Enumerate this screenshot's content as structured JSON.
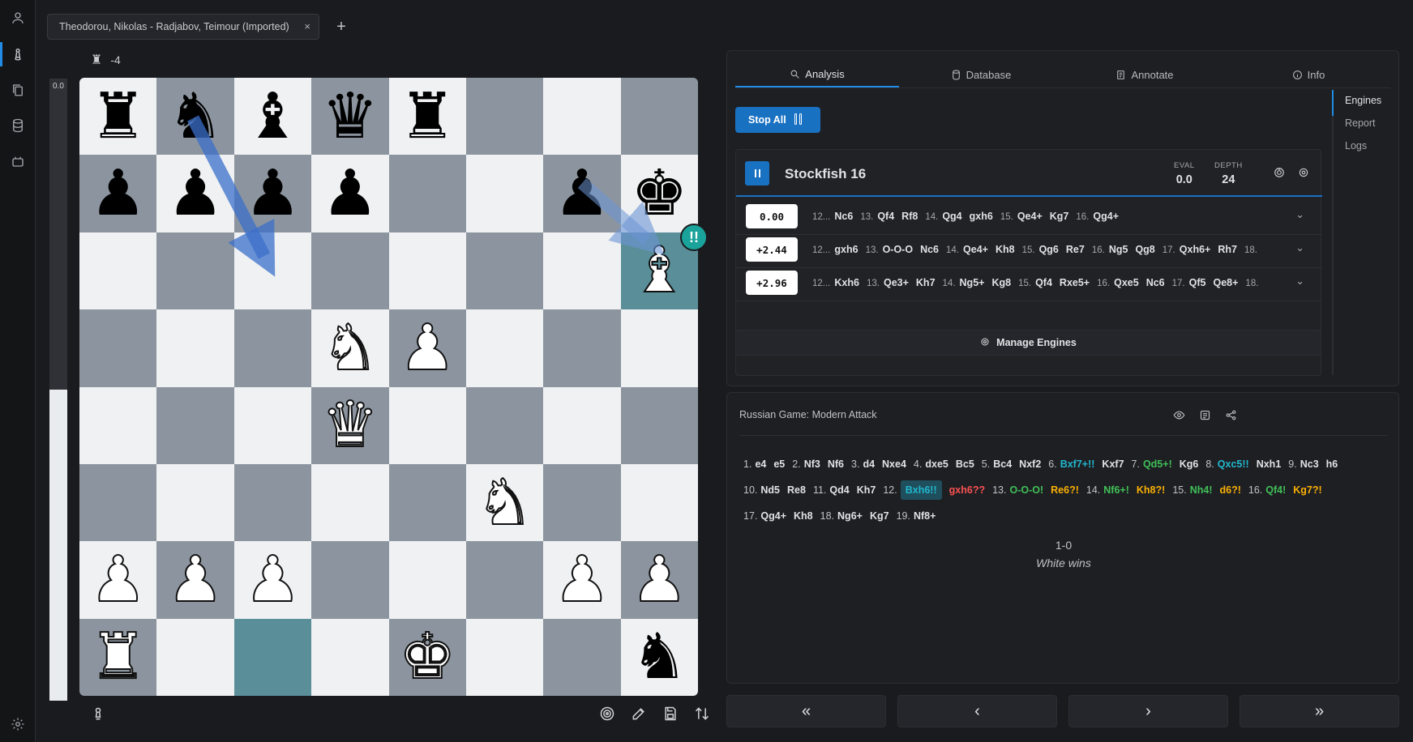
{
  "tab": {
    "title": "Theodorou, Nikolas - Radjabov, Teimour (Imported)",
    "close": "×",
    "new": "+"
  },
  "material": {
    "icon": "white-rook-icon",
    "glyph": "♜",
    "value": "-4"
  },
  "eval_bar": {
    "label": "0.0",
    "white_fraction": 0.5
  },
  "board": {
    "rows": [
      [
        "bR",
        "bN",
        "bB",
        "bQ",
        "bR",
        "",
        "",
        ""
      ],
      [
        "bP",
        "bP",
        "bP",
        "bP",
        "",
        "",
        "bP",
        "bK"
      ],
      [
        "",
        "",
        "",
        "",
        "",
        "",
        "",
        "wB"
      ],
      [
        "",
        "",
        "",
        "wN",
        "wP",
        "",
        "",
        ""
      ],
      [
        "",
        "",
        "",
        "wQ",
        "",
        "",
        "",
        ""
      ],
      [
        "",
        "",
        "",
        "",
        "",
        "wN",
        "",
        ""
      ],
      [
        "wP",
        "wP",
        "wP",
        "",
        "",
        "",
        "wP",
        "wP"
      ],
      [
        "wR",
        "",
        "",
        "",
        "wK",
        "",
        "",
        "bN"
      ]
    ],
    "highlighted": [
      "h6",
      "c1"
    ],
    "annotation_badge": "!!"
  },
  "glyphs": {
    "wK": "♚",
    "wQ": "♛",
    "wR": "♜",
    "wB": "♝",
    "wN": "♞",
    "wP": "♟",
    "bK": "♚",
    "bQ": "♛",
    "bR": "♜",
    "bB": "♝",
    "bN": "♞",
    "bP": "♟"
  },
  "analysis": {
    "tabs": [
      {
        "label": "Analysis",
        "icon": "search-icon"
      },
      {
        "label": "Database",
        "icon": "database-icon"
      },
      {
        "label": "Annotate",
        "icon": "notes-icon"
      },
      {
        "label": "Info",
        "icon": "info-icon"
      }
    ],
    "stop_all": "Stop All",
    "engine": {
      "name": "Stockfish 16",
      "eval_label": "EVAL",
      "eval": "0.0",
      "depth_label": "DEPTH",
      "depth": "24"
    },
    "lines": [
      {
        "score": "0.00",
        "moves": [
          "12...",
          "Nc6",
          "13.",
          "Qf4",
          "Rf8",
          "14.",
          "Qg4",
          "gxh6",
          "15.",
          "Qe4+",
          "Kg7",
          "16.",
          "Qg4+"
        ]
      },
      {
        "score": "+2.44",
        "moves": [
          "12...",
          "gxh6",
          "13.",
          "O-O-O",
          "Nc6",
          "14.",
          "Qe4+",
          "Kh8",
          "15.",
          "Qg6",
          "Re7",
          "16.",
          "Ng5",
          "Qg8",
          "17.",
          "Qxh6+",
          "Rh7",
          "18."
        ]
      },
      {
        "score": "+2.96",
        "moves": [
          "12...",
          "Kxh6",
          "13.",
          "Qe3+",
          "Kh7",
          "14.",
          "Ng5+",
          "Kg8",
          "15.",
          "Qf4",
          "Rxe5+",
          "16.",
          "Qxe5",
          "Nc6",
          "17.",
          "Qf5",
          "Qe8+",
          "18."
        ]
      }
    ],
    "manage_engines": "Manage Engines",
    "side_tabs": [
      "Engines",
      "Report",
      "Logs"
    ]
  },
  "notation": {
    "opening": "Russian Game: Modern Attack",
    "moves": [
      {
        "t": "1.",
        "k": "num"
      },
      {
        "t": "e4"
      },
      {
        "t": "e5"
      },
      {
        "t": "2.",
        "k": "num"
      },
      {
        "t": "Nf3"
      },
      {
        "t": "Nf6"
      },
      {
        "t": "3.",
        "k": "num"
      },
      {
        "t": "d4"
      },
      {
        "t": "Nxe4"
      },
      {
        "t": "4.",
        "k": "num"
      },
      {
        "t": "dxe5"
      },
      {
        "t": "Bc5"
      },
      {
        "t": "5.",
        "k": "num"
      },
      {
        "t": "Bc4"
      },
      {
        "t": "Nxf2"
      },
      {
        "t": "6.",
        "k": "num"
      },
      {
        "t": "Bxf7+!!",
        "k": "brill"
      },
      {
        "t": "Kxf7"
      },
      {
        "t": "7.",
        "k": "num"
      },
      {
        "t": "Qd5+!",
        "k": "good"
      },
      {
        "t": "Kg6"
      },
      {
        "t": "8.",
        "k": "num"
      },
      {
        "t": "Qxc5!!",
        "k": "brill"
      },
      {
        "t": "Nxh1"
      },
      {
        "t": "9.",
        "k": "num"
      },
      {
        "t": "Nc3"
      },
      {
        "t": "h6"
      },
      {
        "t": "10.",
        "k": "num"
      },
      {
        "t": "Nd5"
      },
      {
        "t": "Re8"
      },
      {
        "t": "11.",
        "k": "num"
      },
      {
        "t": "Qd4"
      },
      {
        "t": "Kh7"
      },
      {
        "t": "12.",
        "k": "num"
      },
      {
        "t": "Bxh6!!",
        "k": "sel"
      },
      {
        "t": "gxh6??",
        "k": "bad"
      },
      {
        "t": "13.",
        "k": "num"
      },
      {
        "t": "O-O-O!",
        "k": "good"
      },
      {
        "t": "Re6?!",
        "k": "dub"
      },
      {
        "t": "14.",
        "k": "num"
      },
      {
        "t": "Nf6+!",
        "k": "good"
      },
      {
        "t": "Kh8?!",
        "k": "dub"
      },
      {
        "t": "15.",
        "k": "num"
      },
      {
        "t": "Nh4!",
        "k": "good"
      },
      {
        "t": "d6?!",
        "k": "dub"
      },
      {
        "t": "16.",
        "k": "num"
      },
      {
        "t": "Qf4!",
        "k": "good"
      },
      {
        "t": "Kg7?!",
        "k": "dub"
      },
      {
        "t": "17.",
        "k": "num"
      },
      {
        "t": "Qg4+"
      },
      {
        "t": "Kh8"
      },
      {
        "t": "18.",
        "k": "num"
      },
      {
        "t": "Ng6+"
      },
      {
        "t": "Kg7"
      },
      {
        "t": "19.",
        "k": "num"
      },
      {
        "t": "Nf8+"
      }
    ],
    "result": "1-0",
    "result_text": "White wins"
  },
  "nav": [
    "«",
    "‹",
    "›",
    "»"
  ]
}
